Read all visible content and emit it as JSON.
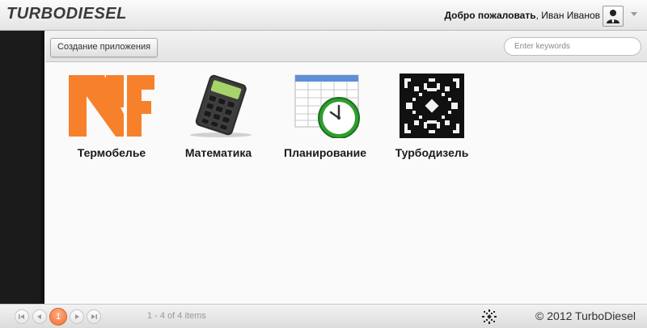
{
  "header": {
    "brand": "TURBODIESEL",
    "welcome_bold": "Добро пожаловать",
    "welcome_rest": ", Иван Иванов",
    "avatar_icon": "user-icon",
    "menu_icon": "chevron-down-icon"
  },
  "toolbar": {
    "create_label": "Создание приложения",
    "search_placeholder": "Enter keywords"
  },
  "apps": [
    {
      "label": "Термобелье",
      "icon": "nf-logo-icon",
      "color": "#f7812b"
    },
    {
      "label": "Математика",
      "icon": "calculator-icon"
    },
    {
      "label": "Планирование",
      "icon": "calendar-clock-icon"
    },
    {
      "label": "Турбодизель",
      "icon": "turbodiesel-ornament-icon"
    }
  ],
  "footer": {
    "current_page": "1",
    "items_info": "1 - 4 of 4 items",
    "copyright": "© 2012 TurboDiesel",
    "pager_icons": [
      "first-page-icon",
      "prev-page-icon",
      "next-page-icon",
      "last-page-icon"
    ]
  },
  "colors": {
    "accent": "#f06a2c",
    "sidebar": "#1b1b1b"
  }
}
